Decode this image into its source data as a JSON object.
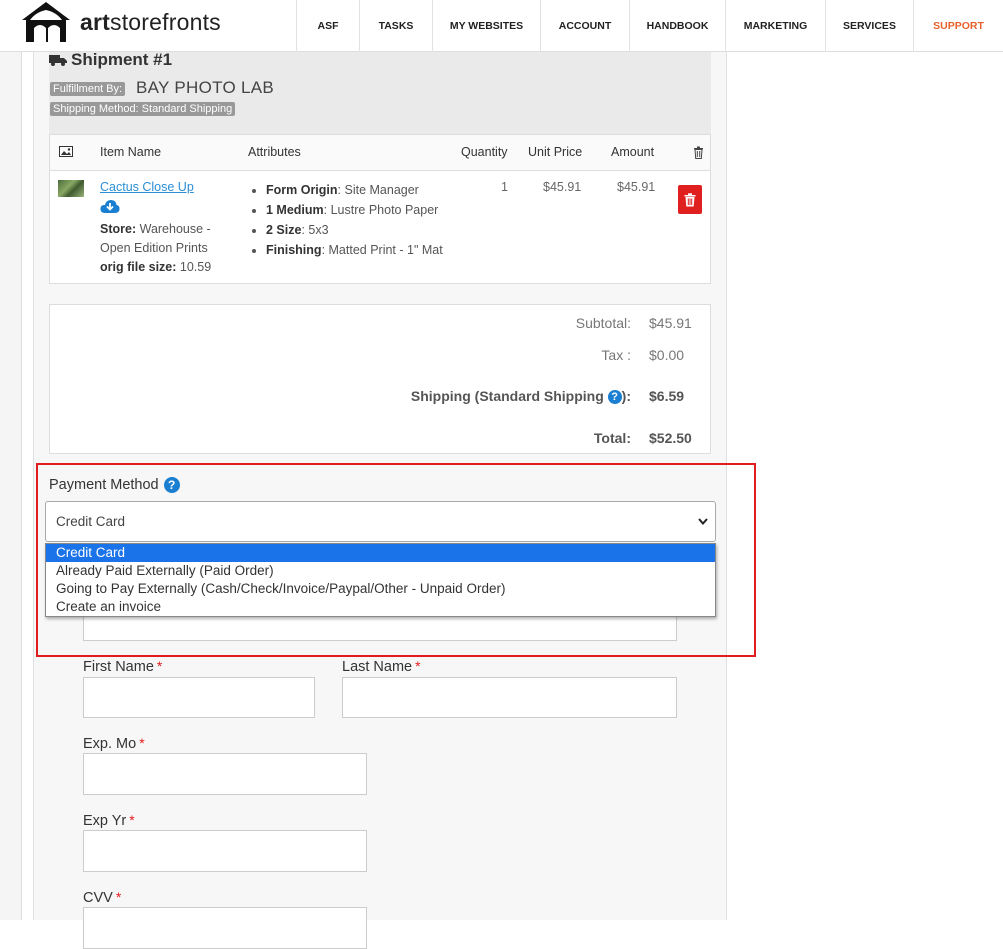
{
  "brand": {
    "text_bold": "art",
    "text_rest": "storefronts"
  },
  "nav": [
    "ASF",
    "TASKS",
    "MY WEBSITES",
    "ACCOUNT",
    "HANDBOOK",
    "MARKETING",
    "SERVICES",
    "SUPPORT"
  ],
  "shipment": {
    "title": "Shipment #1",
    "fulfillment_badge": "Fulfillment By:",
    "lab_name": "BAY PHOTO LAB",
    "shipping_method_badge": "Shipping Method: Standard Shipping"
  },
  "items_table": {
    "headers": {
      "item_name": "Item Name",
      "attributes": "Attributes",
      "quantity": "Quantity",
      "unit_price": "Unit Price",
      "amount": "Amount"
    },
    "row": {
      "name": "Cactus Close Up",
      "store_label": "Store:",
      "store_value": "Warehouse - Open Edition Prints",
      "file_size_label": "orig file size:",
      "file_size_value": "10.59",
      "attributes": [
        {
          "key": "Form Origin",
          "value": "Site Manager"
        },
        {
          "key": "1 Medium",
          "value": "Lustre Photo Paper"
        },
        {
          "key": "2 Size",
          "value": "5x3"
        },
        {
          "key": "Finishing",
          "value": "Matted Print - 1\" Mat"
        }
      ],
      "quantity": "1",
      "unit_price": "$45.91",
      "amount": "$45.91"
    }
  },
  "totals": {
    "subtotal_label": "Subtotal:",
    "subtotal": "$45.91",
    "tax_label": "Tax :",
    "tax": "$0.00",
    "shipping_label": "Shipping (Standard Shipping",
    "shipping_label_end": "):",
    "shipping": "$6.59",
    "total_label": "Total:",
    "total": "$52.50"
  },
  "payment": {
    "label": "Payment Method",
    "selected": "Credit Card",
    "options": [
      "Credit Card",
      "Already Paid Externally (Paid Order)",
      "Going to Pay Externally (Cash/Check/Invoice/Paypal/Other - Unpaid Order)",
      "Create an invoice"
    ]
  },
  "form": {
    "first_name": "First Name",
    "last_name": "Last Name",
    "exp_mo": "Exp. Mo",
    "exp_yr": "Exp Yr",
    "cvv": "CVV",
    "required_mark": "*"
  },
  "colors": {
    "accent": "#2b8fd6",
    "support": "#e8612c",
    "danger": "#e21c1c",
    "select_highlight": "#1a73e8"
  }
}
